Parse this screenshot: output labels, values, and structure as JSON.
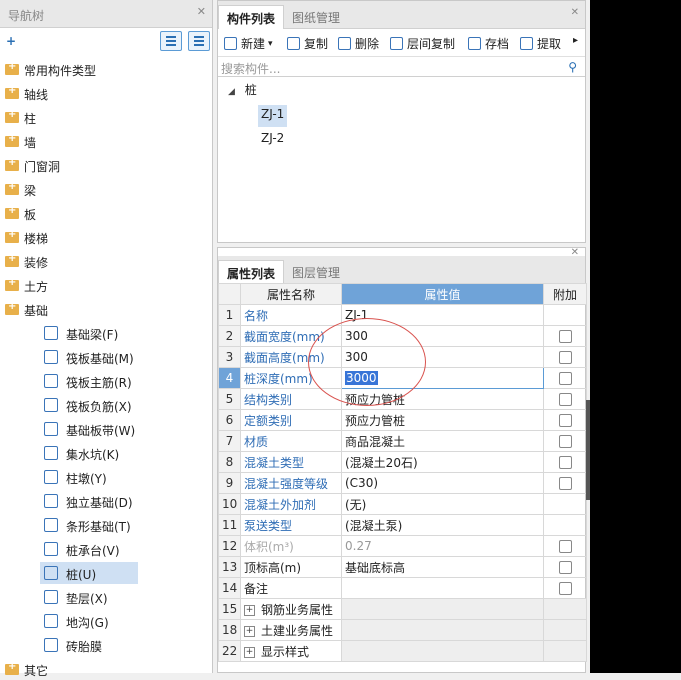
{
  "nav": {
    "title": "导航树",
    "items": [
      {
        "label": "常用构件类型"
      },
      {
        "label": "轴线"
      },
      {
        "label": "柱"
      },
      {
        "label": "墙"
      },
      {
        "label": "门窗洞"
      },
      {
        "label": "梁"
      },
      {
        "label": "板"
      },
      {
        "label": "楼梯"
      },
      {
        "label": "装修"
      },
      {
        "label": "土方"
      },
      {
        "label": "基础"
      }
    ],
    "sub_items": [
      {
        "label": "基础梁(F)"
      },
      {
        "label": "筏板基础(M)"
      },
      {
        "label": "筏板主筋(R)"
      },
      {
        "label": "筏板负筋(X)"
      },
      {
        "label": "基础板带(W)"
      },
      {
        "label": "集水坑(K)"
      },
      {
        "label": "柱墩(Y)"
      },
      {
        "label": "独立基础(D)"
      },
      {
        "label": "条形基础(T)"
      },
      {
        "label": "桩承台(V)"
      },
      {
        "label": "桩(U)"
      },
      {
        "label": "垫层(X)"
      },
      {
        "label": "地沟(G)"
      },
      {
        "label": "砖胎膜"
      }
    ],
    "last_item": "其它"
  },
  "comp": {
    "tabs": [
      "构件列表",
      "图纸管理"
    ],
    "toolbar": [
      "新建",
      "复制",
      "删除",
      "层间复制",
      "存档",
      "提取"
    ],
    "search_placeholder": "搜索构件...",
    "tree_root": "桩",
    "tree_items": [
      "ZJ-1",
      "ZJ-2"
    ]
  },
  "prop": {
    "tabs": [
      "属性列表",
      "图层管理"
    ],
    "headers": [
      "属性名称",
      "属性值",
      "附加"
    ],
    "rows": [
      {
        "num": "1",
        "name": "名称",
        "value": "ZJ-1"
      },
      {
        "num": "2",
        "name": "截面宽度(mm)",
        "value": "300"
      },
      {
        "num": "3",
        "name": "截面高度(mm)",
        "value": "300"
      },
      {
        "num": "4",
        "name": "桩深度(mm)",
        "value": "3000"
      },
      {
        "num": "5",
        "name": "结构类别",
        "value": "预应力管桩"
      },
      {
        "num": "6",
        "name": "定额类别",
        "value": "预应力管桩"
      },
      {
        "num": "7",
        "name": "材质",
        "value": "商品混凝土"
      },
      {
        "num": "8",
        "name": "混凝土类型",
        "value": "(混凝土20石)"
      },
      {
        "num": "9",
        "name": "混凝土强度等级",
        "value": "(C30)"
      },
      {
        "num": "10",
        "name": "混凝土外加剂",
        "value": "(无)"
      },
      {
        "num": "11",
        "name": "泵送类型",
        "value": "(混凝土泵)"
      },
      {
        "num": "12",
        "name": "体积(m³)",
        "value": "0.27"
      },
      {
        "num": "13",
        "name": "顶标高(m)",
        "value": "基础底标高"
      },
      {
        "num": "14",
        "name": "备注",
        "value": ""
      },
      {
        "num": "15",
        "name": "钢筋业务属性",
        "value": ""
      },
      {
        "num": "18",
        "name": "土建业务属性",
        "value": ""
      },
      {
        "num": "22",
        "name": "显示样式",
        "value": ""
      }
    ]
  }
}
